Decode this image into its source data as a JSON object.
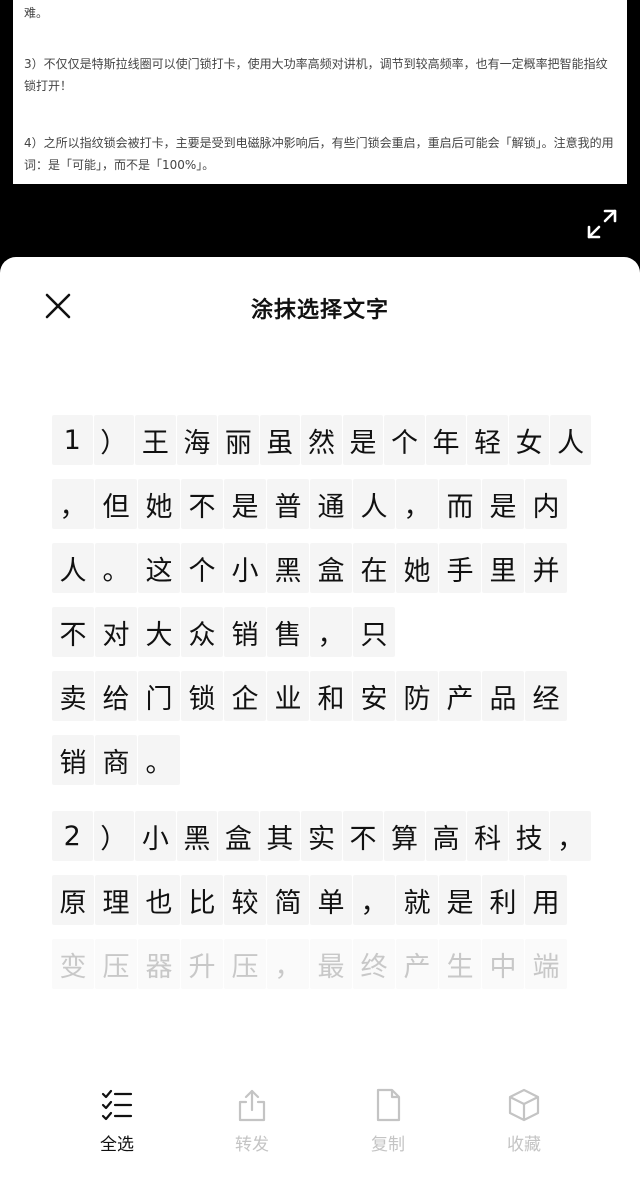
{
  "preview": {
    "para0": "难。",
    "para1": "3）不仅仅是特斯拉线圈可以使门锁打卡，使用大功率高频对讲机，调节到较高频率，也有一定概率把智能指纹锁打开！",
    "para2": "4）之所以指纹锁会被打卡，主要是受到电磁脉冲影响后，有些门锁会重启，重启后可能会「解锁」。注意我的用词：是「可能」，而不是「100%」。"
  },
  "sheet": {
    "title": "涂抹选择文字",
    "paragraphs": [
      [
        "1）王海丽虽然是个年轻女人",
        "，但她不是普通人，而是内",
        "人。这个小黑盒在她手里并",
        "不对大众销售，只",
        "卖给门锁企业和安防产品经",
        "销商。"
      ],
      [
        "2）小黑盒其实不算高科技，",
        "原理也比较简单，就是利用",
        "变压器升压，最终产生中端"
      ]
    ]
  },
  "toolbar": {
    "select_all": "全选",
    "forward": "转发",
    "copy": "复制",
    "favorite": "收藏"
  },
  "colors": {
    "char_bg": "#f5f5f5",
    "disabled": "#c4c4c4"
  }
}
